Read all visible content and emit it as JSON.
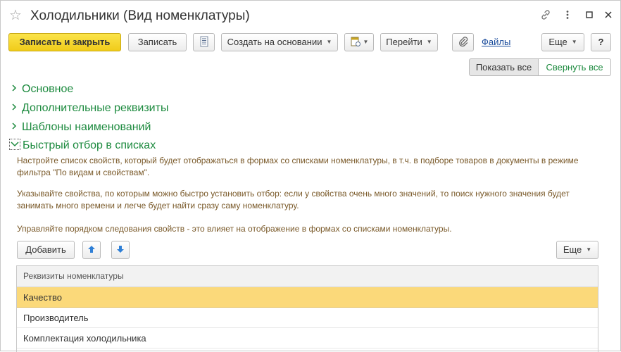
{
  "window": {
    "title": "Холодильники (Вид номенклатуры)"
  },
  "toolbar": {
    "save_close": "Записать и закрыть",
    "save": "Записать",
    "create_based": "Создать на основании",
    "goto": "Перейти",
    "files": "Файлы",
    "more": "Еще",
    "help": "?"
  },
  "view_toggle": {
    "show_all": "Показать все",
    "collapse_all": "Свернуть все"
  },
  "groups": [
    {
      "label": "Основное",
      "open": false
    },
    {
      "label": "Дополнительные реквизиты",
      "open": false
    },
    {
      "label": "Шаблоны наименований",
      "open": false
    },
    {
      "label": "Быстрый отбор в списках",
      "open": true
    }
  ],
  "quick_filter": {
    "desc1": "Настройте список свойств, который будет отображаться в формах со списками номенклатуры, в т.ч. в подборе товаров в документы в режиме фильтра \"По видам и свойствам\".",
    "desc2": "Указывайте свойства, по которым можно быстро установить отбор: если у свойства очень много значений, то поиск нужного значения будет занимать много времени и легче будет найти сразу саму номенклатуру.",
    "desc3": "Управляйте порядком следования свойств - это влияет на отображение в формах со списками номенклатуры.",
    "add_button": "Добавить",
    "more_button": "Еще",
    "table_header": "Реквизиты номенклатуры",
    "rows": [
      "Качество",
      "Производитель",
      "Комплектация холодильника"
    ]
  },
  "colors": {
    "accent_green": "#1c8a3e",
    "primary_yellow": "#f5d42a",
    "selected_row": "#fbd97a"
  }
}
